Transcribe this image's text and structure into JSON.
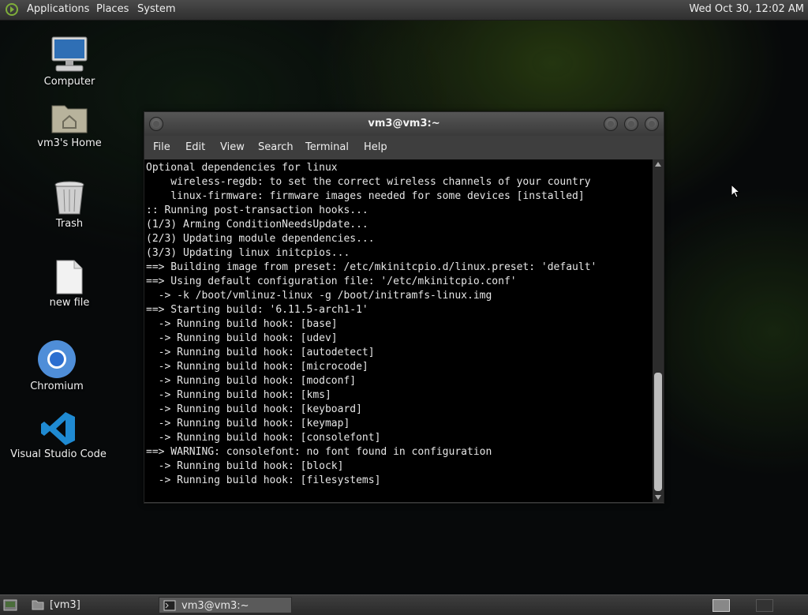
{
  "top_panel": {
    "menus": [
      "Applications",
      "Places",
      "System"
    ],
    "clock": "Wed Oct 30, 12:02 AM"
  },
  "desktop": {
    "icons": [
      {
        "label": "Computer",
        "icon": "computer-icon"
      },
      {
        "label": "vm3's Home",
        "icon": "home-folder-icon"
      },
      {
        "label": "Trash",
        "icon": "trash-icon"
      },
      {
        "label": "new file",
        "icon": "file-icon"
      },
      {
        "label": "Chromium",
        "icon": "chromium-icon"
      },
      {
        "label": "Visual Studio Code",
        "icon": "vscode-icon"
      }
    ]
  },
  "terminal": {
    "title": "vm3@vm3:~",
    "menu": [
      "File",
      "Edit",
      "View",
      "Search",
      "Terminal",
      "Help"
    ],
    "lines": [
      "Optional dependencies for linux",
      "    wireless-regdb: to set the correct wireless channels of your country",
      "    linux-firmware: firmware images needed for some devices [installed]",
      ":: Running post-transaction hooks...",
      "(1/3) Arming ConditionNeedsUpdate...",
      "(2/3) Updating module dependencies...",
      "(3/3) Updating linux initcpios...",
      "==> Building image from preset: /etc/mkinitcpio.d/linux.preset: 'default'",
      "==> Using default configuration file: '/etc/mkinitcpio.conf'",
      "  -> -k /boot/vmlinuz-linux -g /boot/initramfs-linux.img",
      "==> Starting build: '6.11.5-arch1-1'",
      "  -> Running build hook: [base]",
      "  -> Running build hook: [udev]",
      "  -> Running build hook: [autodetect]",
      "  -> Running build hook: [microcode]",
      "  -> Running build hook: [modconf]",
      "  -> Running build hook: [kms]",
      "  -> Running build hook: [keyboard]",
      "  -> Running build hook: [keymap]",
      "  -> Running build hook: [consolefont]",
      "==> WARNING: consolefont: no font found in configuration",
      "  -> Running build hook: [block]",
      "  -> Running build hook: [filesystems]"
    ]
  },
  "taskbar": {
    "items": [
      "[vm3]",
      "vm3@vm3:~"
    ]
  }
}
